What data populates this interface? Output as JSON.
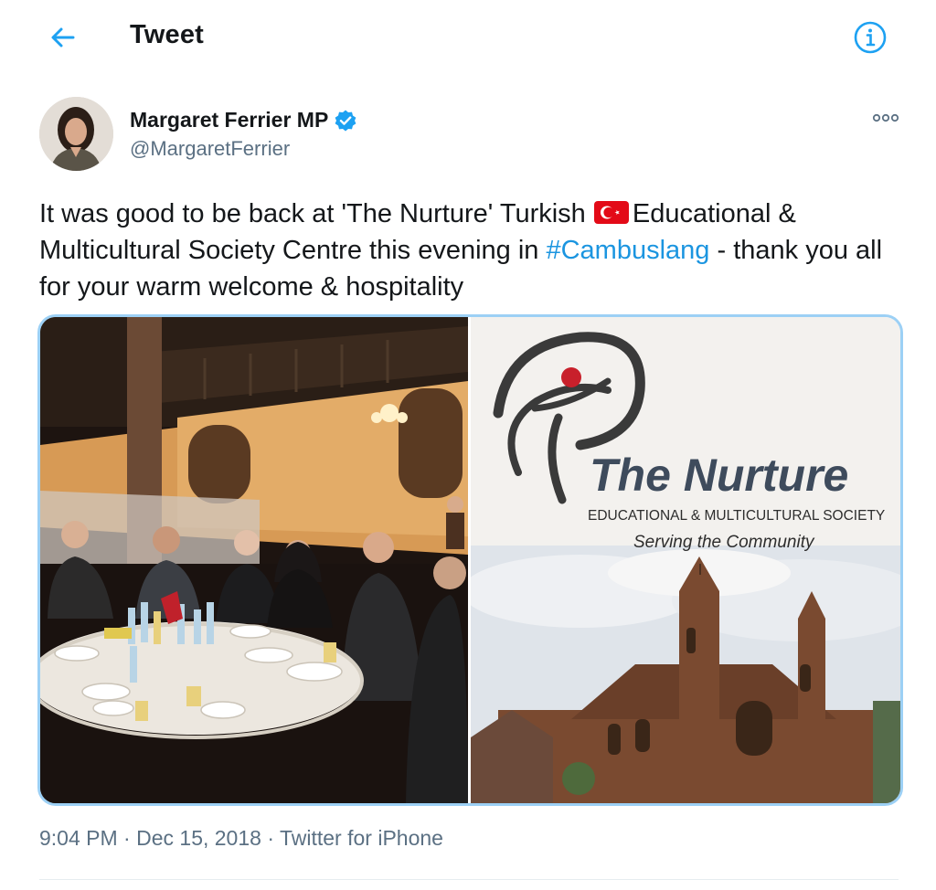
{
  "header": {
    "title": "Tweet",
    "back_icon": "arrow-left-icon",
    "info_icon": "info-circle-icon",
    "accent_color": "#1da1f2"
  },
  "author": {
    "display_name": "Margaret Ferrier MP",
    "handle": "@MargaretFerrier",
    "verified": true,
    "more_icon": "more-options-icon"
  },
  "tweet": {
    "text_part1": "It was good to be back at 'The Nurture' Turkish ",
    "flag_icon": "turkey-flag-icon",
    "text_part2": "Educational & Multicultural Society Centre this evening in ",
    "hashtag": "#Cambuslang",
    "text_part3": " - thank you all for your warm welcome & hospitality",
    "hashtag_color": "#1b95e0"
  },
  "media": {
    "photo_left_alt": "Group of guests seated around a dinner table in a hall",
    "photo_right_logo_title": "The Nurture",
    "photo_right_logo_subtitle": "EDUCATIONAL & MULTICULTURAL SOCIETY",
    "photo_right_logo_tagline": "Serving the Community"
  },
  "meta": {
    "time": "9:04 PM",
    "date": "Dec 15, 2018",
    "source": "Twitter for iPhone",
    "separator": "·"
  }
}
